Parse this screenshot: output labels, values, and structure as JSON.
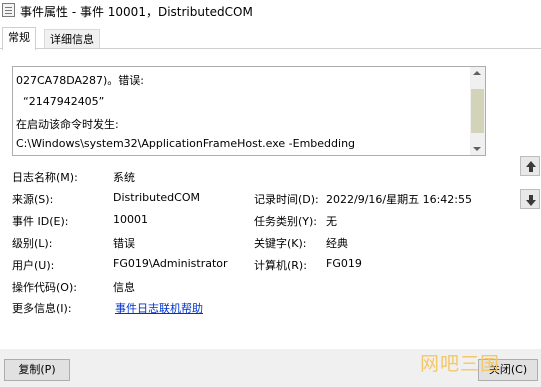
{
  "window": {
    "title": "事件属性 - 事件 10001，DistributedCOM"
  },
  "tabs": [
    {
      "label": "常规"
    },
    {
      "label": "详细信息"
    }
  ],
  "description": {
    "lines": [
      "027CA78DA287)。错误:",
      "“2147942405”",
      "在启动该命令时发生:",
      "C:\\Windows\\system32\\ApplicationFrameHost.exe -Embedding"
    ]
  },
  "fields": {
    "log_name": {
      "label": "日志名称(M):",
      "value": "系统"
    },
    "source": {
      "label": "来源(S):",
      "value": "DistributedCOM"
    },
    "logged": {
      "label": "记录时间(D):",
      "value": "2022/9/16/星期五 16:42:55"
    },
    "event_id": {
      "label": "事件 ID(E):",
      "value": "10001"
    },
    "task_category": {
      "label": "任务类别(Y):",
      "value": "无"
    },
    "level": {
      "label": "级别(L):",
      "value": "错误"
    },
    "keywords": {
      "label": "关键字(K):",
      "value": "经典"
    },
    "user": {
      "label": "用户(U):",
      "value": "FG019\\Administrator"
    },
    "computer": {
      "label": "计算机(R):",
      "value": "FG019"
    },
    "opcode": {
      "label": "操作代码(O):",
      "value": "信息"
    },
    "more_info": {
      "label": "更多信息(I):",
      "link": "事件日志联机帮助"
    }
  },
  "buttons": {
    "copy": "复制(P)",
    "close": "关闭(C)"
  },
  "watermark": "网吧三国"
}
